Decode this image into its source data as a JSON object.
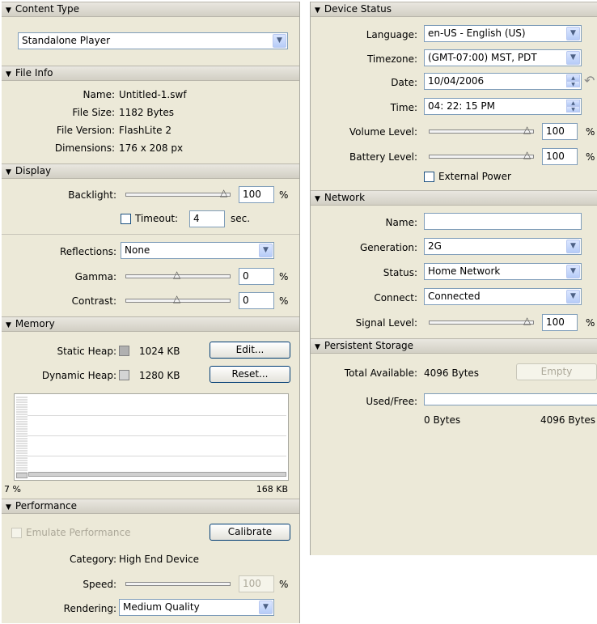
{
  "content_type": {
    "header": "Content Type",
    "player": "Standalone Player"
  },
  "file_info": {
    "header": "File Info",
    "name_label": "Name:",
    "name_value": "Untitled-1.swf",
    "size_label": "File Size:",
    "size_value": "1182 Bytes",
    "version_label": "File Version:",
    "version_value": "FlashLite 2",
    "dims_label": "Dimensions:",
    "dims_value": "176 x 208 px"
  },
  "display": {
    "header": "Display",
    "backlight_label": "Backlight:",
    "backlight_value": "100",
    "backlight_level_pct": 100,
    "timeout_label": "Timeout:",
    "timeout_value": "4",
    "sec_label": "sec.",
    "reflections_label": "Reflections:",
    "reflections_value": "None",
    "gamma_label": "Gamma:",
    "gamma_value": "0",
    "gamma_level_pct": 50,
    "contrast_label": "Contrast:",
    "contrast_value": "0",
    "contrast_level_pct": 50,
    "percent": "%"
  },
  "memory": {
    "header": "Memory",
    "static_label": "Static Heap:",
    "static_value": "1024 KB",
    "dynamic_label": "Dynamic Heap:",
    "dynamic_value": "1280 KB",
    "edit_button": "Edit...",
    "reset_button": "Reset...",
    "usage_percent": "7 %",
    "usage_total": "168 KB",
    "colors": {
      "static": "#b0b0b0",
      "dynamic": "#d4d4d4"
    }
  },
  "performance": {
    "header": "Performance",
    "emulate_label": "Emulate Performance",
    "calibrate_button": "Calibrate",
    "category_label": "Category:",
    "category_value": "High End Device",
    "speed_label": "Speed:",
    "speed_value": "100",
    "speed_level_pct": 100,
    "rendering_label": "Rendering:",
    "rendering_value": "Medium Quality",
    "percent": "%"
  },
  "device_status": {
    "header": "Device Status",
    "language_label": "Language:",
    "language_value": "en-US - English (US)",
    "timezone_label": "Timezone:",
    "timezone_value": "(GMT-07:00) MST, PDT",
    "date_label": "Date:",
    "date_value": "10/04/2006",
    "time_label": "Time:",
    "time_value": "04: 22: 15 PM",
    "volume_label": "Volume Level:",
    "volume_value": "100",
    "volume_level_pct": 100,
    "battery_label": "Battery Level:",
    "battery_value": "100",
    "battery_level_pct": 100,
    "external_power_label": "External Power",
    "percent": "%"
  },
  "network": {
    "header": "Network",
    "name_label": "Name:",
    "name_value": "",
    "generation_label": "Generation:",
    "generation_value": "2G",
    "status_label": "Status:",
    "status_value": "Home Network",
    "connect_label": "Connect:",
    "connect_value": "Connected",
    "signal_label": "Signal Level:",
    "signal_value": "100",
    "signal_level_pct": 100,
    "percent": "%"
  },
  "persistent_storage": {
    "header": "Persistent Storage",
    "total_label": "Total Available:",
    "total_value": "4096 Bytes",
    "empty_button": "Empty",
    "used_label": "Used/Free:",
    "used_value": "0 Bytes",
    "free_value": "4096 Bytes",
    "used_fraction": 0
  },
  "icons": {
    "collapse": "▼",
    "dropdown": "▼",
    "spin_up": "▲",
    "spin_down": "▼",
    "slider_thumb": "△",
    "revert": "↶"
  }
}
